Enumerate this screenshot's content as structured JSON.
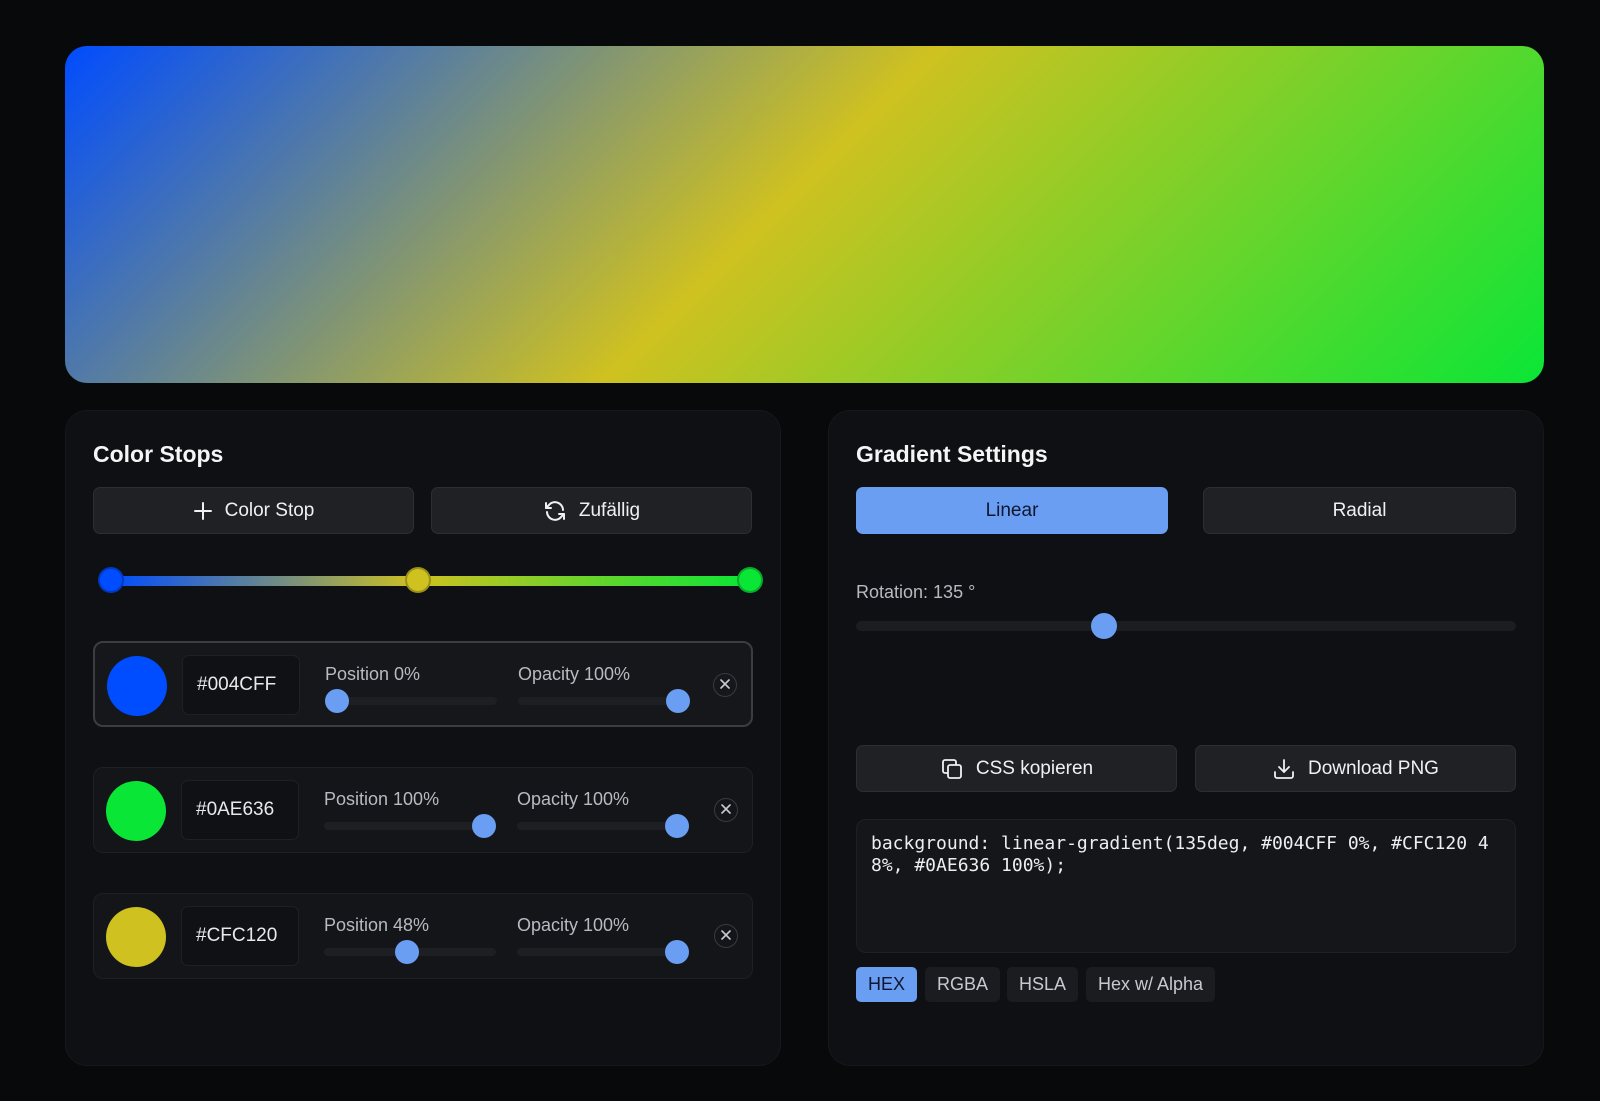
{
  "colors": {
    "accent": "#6a9ef2",
    "stop_blue": "#004CFF",
    "stop_green": "#0AE636",
    "stop_yellow": "#CFC120"
  },
  "preview": {
    "angle_deg": 135,
    "stops": [
      {
        "color": "#004CFF",
        "position_pct": 0
      },
      {
        "color": "#CFC120",
        "position_pct": 48
      },
      {
        "color": "#0AE636",
        "position_pct": 100
      }
    ]
  },
  "color_stops_panel": {
    "title": "Color Stops",
    "add_button_label": "Color Stop",
    "add_button_icon": "plus-icon",
    "random_button_label": "Zufällig",
    "random_button_icon": "refresh-icon",
    "bar_stops_pct": [
      0,
      48,
      100
    ],
    "stops": [
      {
        "hex": "#004CFF",
        "position_label": "Position 0%",
        "position_pct": 0,
        "opacity_label": "Opacity 100%",
        "opacity_pct": 100,
        "selected": true
      },
      {
        "hex": "#0AE636",
        "position_label": "Position 100%",
        "position_pct": 100,
        "opacity_label": "Opacity 100%",
        "opacity_pct": 100,
        "selected": false
      },
      {
        "hex": "#CFC120",
        "position_label": "Position 48%",
        "position_pct": 48,
        "opacity_label": "Opacity 100%",
        "opacity_pct": 100,
        "selected": false
      }
    ],
    "remove_icon": "close-icon"
  },
  "gradient_settings": {
    "title": "Gradient Settings",
    "type_linear_label": "Linear",
    "type_radial_label": "Radial",
    "active_type": "Linear",
    "rotation_label": "Rotation:  135 °",
    "rotation_deg": 135,
    "copy_button_label": "CSS kopieren",
    "copy_button_icon": "copy-icon",
    "download_button_label": "Download PNG",
    "download_button_icon": "download-icon",
    "css_code": "background: linear-gradient(135deg, #004CFF 0%, #CFC120 48%, #0AE636 100%);",
    "format_tabs": [
      "HEX",
      "RGBA",
      "HSLA",
      "Hex w/ Alpha"
    ],
    "active_format": "HEX"
  }
}
